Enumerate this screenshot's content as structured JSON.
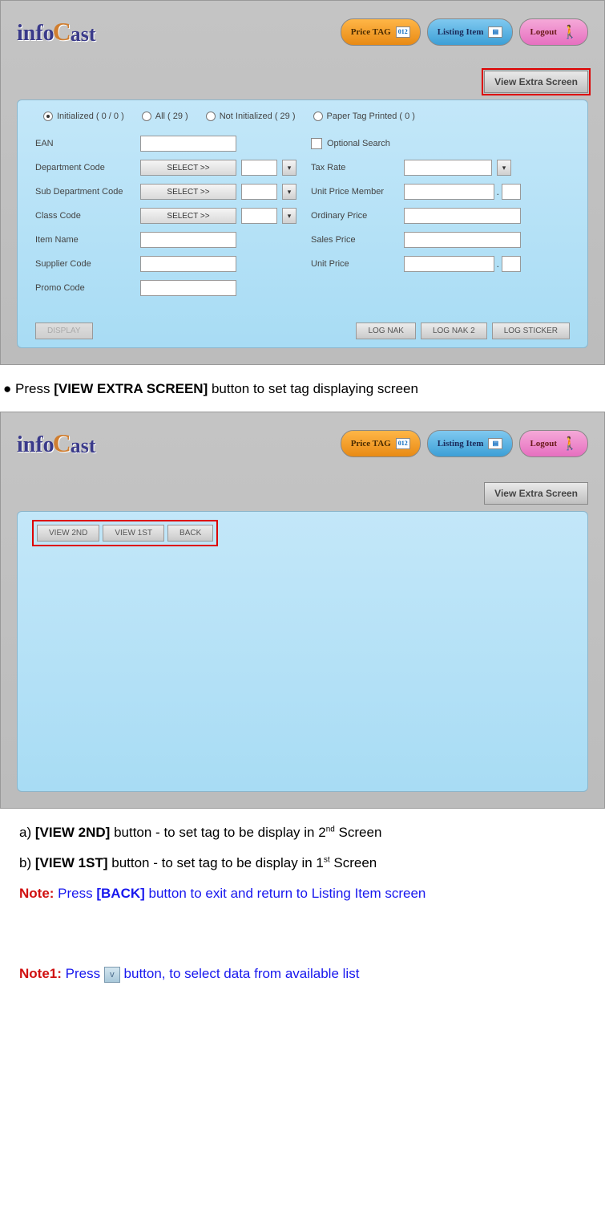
{
  "logo": {
    "part1": "info",
    "part2": "C",
    "part3": "ast"
  },
  "nav": {
    "price_tag": "Price TAG",
    "price_tag_badge": "012",
    "listing_item": "Listing Item",
    "logout": "Logout"
  },
  "ves_button": "View Extra Screen",
  "radios": {
    "initialized": "Initialized  ( 0 / 0 )",
    "all": "All  ( 29 )",
    "not_initialized": "Not Initialized  ( 29 )",
    "paper_tag": "Paper Tag Printed  ( 0 )"
  },
  "labels": {
    "ean": "EAN",
    "dept": "Department Code",
    "subdept": "Sub Department Code",
    "class": "Class Code",
    "item": "Item Name",
    "supplier": "Supplier Code",
    "promo": "Promo Code",
    "optional": "Optional Search",
    "tax": "Tax Rate",
    "upm": "Unit Price Member",
    "ord": "Ordinary Price",
    "sales": "Sales Price",
    "unit": "Unit Price"
  },
  "select_btn": "SELECT >>",
  "buttons": {
    "display": "DISPLAY",
    "log_nak": "LOG NAK",
    "log_nak2": "LOG NAK 2",
    "log_sticker": "LOG STICKER",
    "view2nd": "VIEW 2ND",
    "view1st": "VIEW 1ST",
    "back": "BACK"
  },
  "doc": {
    "bullet": "Press ",
    "bullet_bold": "[VIEW EXTRA SCREEN]",
    "bullet_tail": " button to set tag displaying screen",
    "line_a_pre": "a) ",
    "line_a_bold": "[VIEW 2ND]",
    "line_a_mid": " button - to set tag to be display in 2",
    "line_a_sup": "nd",
    "line_a_end": " Screen",
    "line_b_pre": "b) ",
    "line_b_bold": "[VIEW 1ST]",
    "line_b_mid": " button - to set tag to be display in 1",
    "line_b_sup": "st",
    "line_b_end": " Screen",
    "note_lbl": "Note:",
    "note_pre": " Press ",
    "note_bold": "[BACK]",
    "note_end": " button to exit and return to Listing Item screen",
    "note1_lbl": "Note1:",
    "note1_pre": " Press ",
    "note1_end": " button, to select data from available list",
    "dd_glyph": "v"
  }
}
